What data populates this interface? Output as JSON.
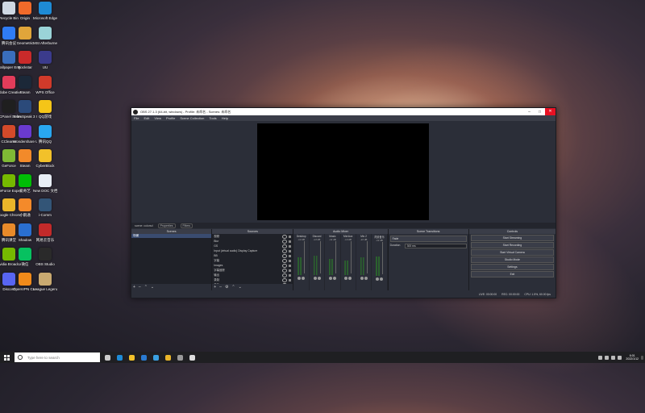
{
  "desktop": {
    "icons": [
      {
        "label": "Recycle Bin",
        "color": "#cfd8e3"
      },
      {
        "label": "Origin",
        "color": "#f06a2a"
      },
      {
        "label": "Microsoft Edge",
        "color": "#1e8bd6"
      },
      {
        "label": "腾讯会议",
        "color": "#2f7cf6"
      },
      {
        "label": "Geometric",
        "color": "#e0a53a"
      },
      {
        "label": "MSI Afterburner",
        "color": "#9ad3d8"
      },
      {
        "label": "Wallpaper Engine",
        "color": "#3a6ebc"
      },
      {
        "label": "Rockstar",
        "color": "#c92a2a"
      },
      {
        "label": "UU",
        "color": "#3b3b8c"
      },
      {
        "label": "Adobe Creative",
        "color": "#e23c5a"
      },
      {
        "label": "Steam",
        "color": "#1b2838"
      },
      {
        "label": "WPS Office",
        "color": "#d03a2a"
      },
      {
        "label": "PCPanel Software",
        "color": "#1f1f1f"
      },
      {
        "label": "TeamSpeak 3 Client",
        "color": "#2b4a7a"
      },
      {
        "label": "QQ游戏",
        "color": "#f5c518"
      },
      {
        "label": "CCleaner",
        "color": "#d44a2a"
      },
      {
        "label": "Wondershare UniConvert",
        "color": "#6a3ad0"
      },
      {
        "label": "腾讯QQ",
        "color": "#29a7f0"
      },
      {
        "label": "GeForce",
        "color": "#7fb935"
      },
      {
        "label": "Steam",
        "color": "#f28a2a"
      },
      {
        "label": "CyberBlock",
        "color": "#f2c12a"
      },
      {
        "label": "GeForce Experience",
        "color": "#76b900"
      },
      {
        "label": "爱奇艺",
        "color": "#00be06"
      },
      {
        "label": "New DOC 文档",
        "color": "#e8eef6"
      },
      {
        "label": "Google Chrome",
        "color": "#e9b52a"
      },
      {
        "label": "小鹅通",
        "color": "#f48a2a"
      },
      {
        "label": "i-Comm",
        "color": "#335577"
      },
      {
        "label": "腾讯课堂",
        "color": "#e88a2a"
      },
      {
        "label": "Shadow",
        "color": "#2a6fd0"
      },
      {
        "label": "网易云音乐",
        "color": "#c22a2a"
      },
      {
        "label": "Nvidia Broadcast",
        "color": "#76b900"
      },
      {
        "label": "微信",
        "color": "#07c160"
      },
      {
        "label": "OBS Studio",
        "color": "#2a2a2a"
      },
      {
        "label": "Discord",
        "color": "#5865f2"
      },
      {
        "label": "OpenVPN Connect",
        "color": "#f08a1a"
      },
      {
        "label": "League Legends",
        "color": "#c9aa71"
      }
    ]
  },
  "obs": {
    "window_title": "OBS 27.1.3 (64-bit, windows) - Profile: 未命名 - Scenes: 未命名",
    "menu": [
      "File",
      "Edit",
      "View",
      "Profile",
      "Scene Collection",
      "Tools",
      "Help"
    ],
    "scenebar_label": "scene: colorsd",
    "scenebar_buttons": [
      "Properties",
      "Filters"
    ],
    "scenes": {
      "title": "Scenes",
      "items": [
        "场景"
      ]
    },
    "sources": {
      "title": "Sources",
      "items": [
        "视频",
        "Blur",
        "GS",
        "Input (virtual audio) Display Capture",
        "BB",
        "字幕",
        "Images",
        "字幕追踪",
        "输出",
        "录制",
        "音乐",
        "背景"
      ]
    },
    "mixer": {
      "title": "Audio Mixer",
      "channels": [
        {
          "name": "Desktop",
          "db": "-inf dB",
          "level": 0.55
        },
        {
          "name": "Discord",
          "db": "-inf dB",
          "level": 0.6
        },
        {
          "name": "Music",
          "db": "-inf dB",
          "level": 0.5
        },
        {
          "name": "Mic/Aux",
          "db": "-inf dB",
          "level": 0.45
        },
        {
          "name": "Mic 2",
          "db": "-inf dB",
          "level": 0.55
        },
        {
          "name": "背景音乐",
          "db": "-inf dB",
          "level": 0.6
        }
      ]
    },
    "transitions": {
      "title": "Scene Transitions",
      "selected": "Fade",
      "duration_label": "Duration",
      "duration_value": "300 ms"
    },
    "controls": {
      "title": "Controls",
      "buttons": [
        "Start Streaming",
        "Start Recording",
        "Start Virtual Camera",
        "Studio Mode",
        "Settings",
        "Exit"
      ]
    },
    "status": [
      "LIVE: 00:00:00",
      "REC: 00:00:00",
      "CPU: 1.5%, 60.00 fps"
    ]
  },
  "taskbar": {
    "search_placeholder": "Type here to search",
    "apps": [
      {
        "name": "task-view",
        "color": "#cccccc"
      },
      {
        "name": "edge",
        "color": "#1e8bd6"
      },
      {
        "name": "file-explorer",
        "color": "#f2c12a"
      },
      {
        "name": "mail",
        "color": "#2a7ad0"
      },
      {
        "name": "store",
        "color": "#3aa0e0"
      },
      {
        "name": "chrome",
        "color": "#e9b52a"
      },
      {
        "name": "settings",
        "color": "#999999"
      },
      {
        "name": "obs",
        "color": "#dddddd"
      }
    ],
    "time": "6:01",
    "date": "2022/1/12"
  }
}
